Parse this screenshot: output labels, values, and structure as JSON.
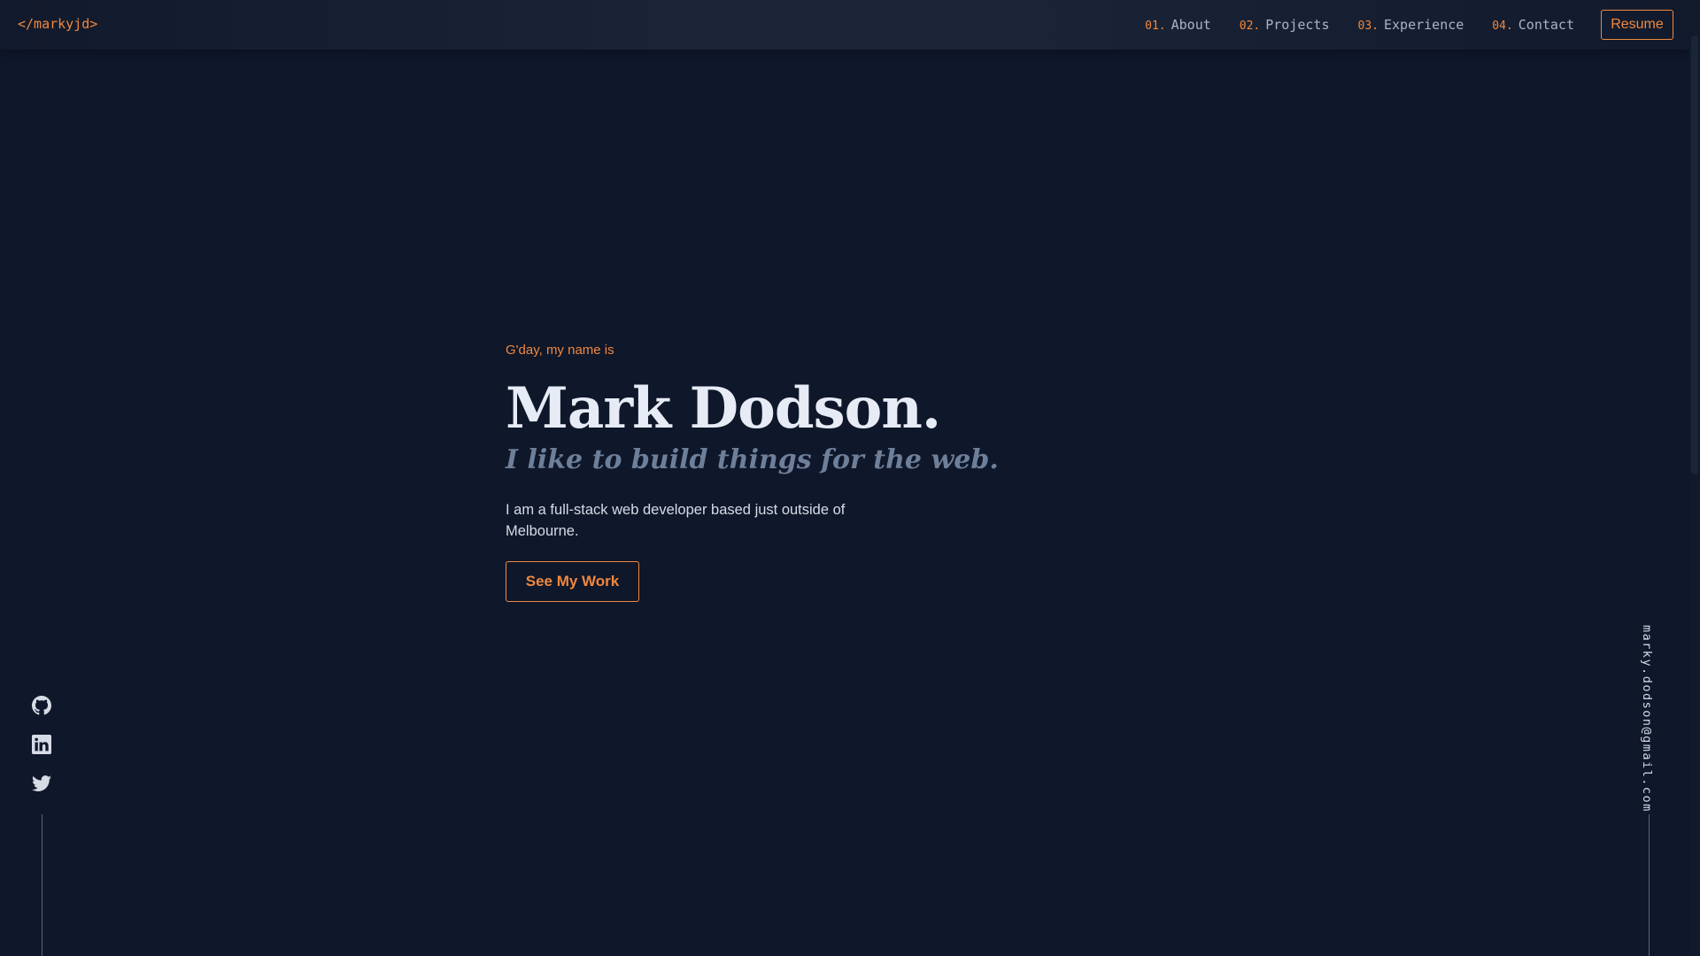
{
  "nav": {
    "logo": "</markyjd>",
    "links": [
      {
        "num": "01.",
        "label": "About"
      },
      {
        "num": "02.",
        "label": "Projects"
      },
      {
        "num": "03.",
        "label": "Experience"
      },
      {
        "num": "04.",
        "label": "Contact"
      }
    ],
    "resume_label": "Resume"
  },
  "hero": {
    "greeting": "G'day, my name is",
    "name": "Mark Dodson.",
    "tagline": "I like to build things for the web.",
    "bio": "I am a full-stack web developer based just outside of Melbourne.",
    "cta_label": "See My Work"
  },
  "socials": [
    {
      "icon": "github-icon"
    },
    {
      "icon": "linkedin-icon"
    },
    {
      "icon": "twitter-icon"
    }
  ],
  "email": "marky.dodson@gmail.com",
  "colors": {
    "background": "#0f172a",
    "accent": "#f0883e",
    "heading": "#e6ebf5",
    "muted": "#6e7f99"
  }
}
